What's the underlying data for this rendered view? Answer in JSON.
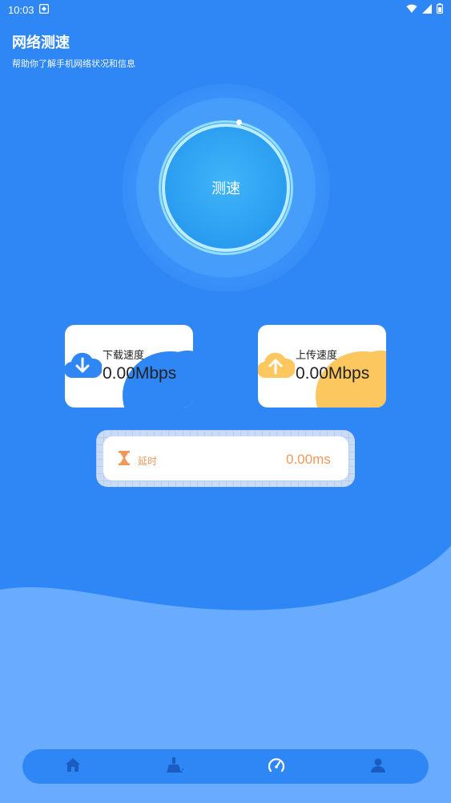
{
  "status_bar": {
    "time": "10:03"
  },
  "header": {
    "title": "网络测速",
    "subtitle": "帮助你了解手机网络状况和信息"
  },
  "speed_button": {
    "label": "测速"
  },
  "download": {
    "label": "下载速度",
    "value": "0.00Mbps",
    "accent": "#2f87f5"
  },
  "upload": {
    "label": "上传速度",
    "value": "0.00Mbps",
    "accent": "#fcc75f"
  },
  "latency": {
    "label": "延时",
    "value": "0.00ms",
    "accent": "#f0985a"
  },
  "bottom_nav": {
    "items": [
      {
        "icon": "home-icon"
      },
      {
        "icon": "broom-icon"
      },
      {
        "icon": "speedometer-icon",
        "active": true
      },
      {
        "icon": "user-icon"
      }
    ]
  }
}
